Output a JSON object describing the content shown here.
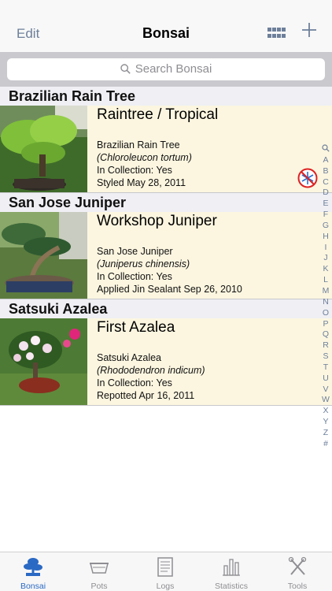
{
  "nav": {
    "edit_label": "Edit",
    "title": "Bonsai"
  },
  "search": {
    "placeholder": "Search Bonsai"
  },
  "sections": [
    {
      "header": "Brazilian Rain Tree",
      "item": {
        "name": "Raintree / Tropical",
        "common": "Brazilian Rain Tree",
        "latin": "(Chloroleucon tortum)",
        "collection": "In Collection: Yes",
        "event": "Styled May 28, 2011",
        "badge_icon": "no-frost-icon"
      }
    },
    {
      "header": "San Jose Juniper",
      "item": {
        "name": "Workshop Juniper",
        "common": "San Jose Juniper",
        "latin": "(Juniperus chinensis)",
        "collection": "In Collection: Yes",
        "event": "Applied Jin Sealant Sep 26, 2010"
      }
    },
    {
      "header": "Satsuki Azalea",
      "item": {
        "name": "First Azalea",
        "common": "Satsuki Azalea",
        "latin": "(Rhododendron indicum)",
        "collection": "In Collection: Yes",
        "event": "Repotted Apr 16, 2011"
      }
    }
  ],
  "index": [
    "A",
    "B",
    "C",
    "D",
    "E",
    "F",
    "G",
    "H",
    "I",
    "J",
    "K",
    "L",
    "M",
    "N",
    "O",
    "P",
    "Q",
    "R",
    "S",
    "T",
    "U",
    "V",
    "W",
    "X",
    "Y",
    "Z",
    "#"
  ],
  "tabs": [
    {
      "label": "Bonsai",
      "icon": "tree-icon"
    },
    {
      "label": "Pots",
      "icon": "pot-icon"
    },
    {
      "label": "Logs",
      "icon": "logs-icon"
    },
    {
      "label": "Statistics",
      "icon": "statistics-icon"
    },
    {
      "label": "Tools",
      "icon": "tools-icon"
    }
  ],
  "colors": {
    "accent": "#6d7f9a",
    "tab_active": "#2a69c4",
    "row_background": "#fcf6e0",
    "section_background": "#efeff4"
  }
}
